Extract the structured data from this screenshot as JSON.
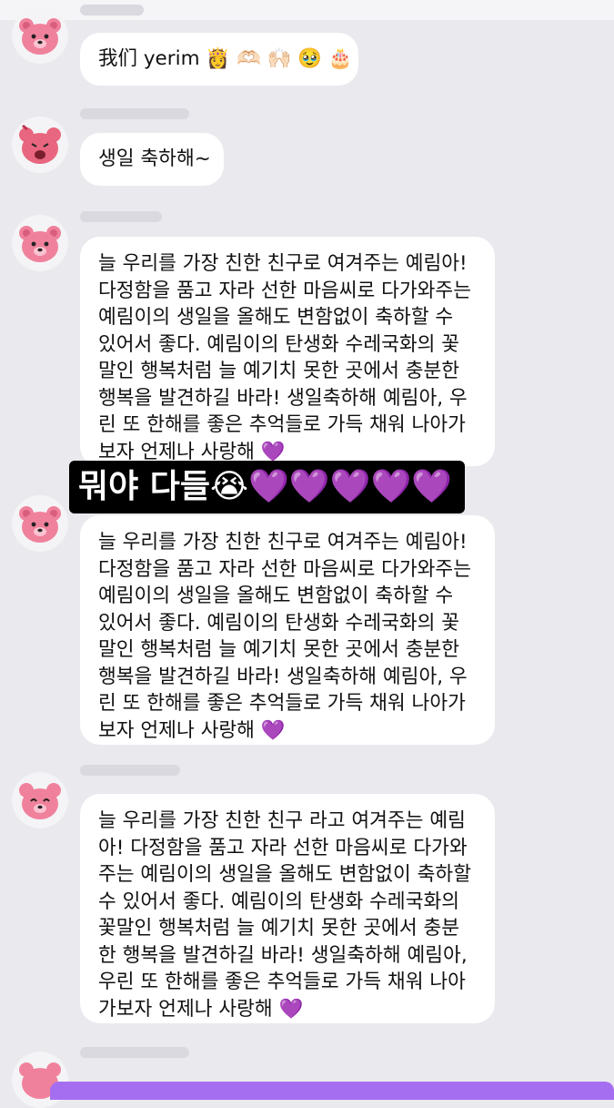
{
  "messages": [
    {
      "id": "m1",
      "text": "我们 yerim 👸 🫶🏻 🙌🏻 🥹 🎂"
    },
    {
      "id": "m2",
      "text": "생일 축하해~"
    },
    {
      "id": "m3",
      "lines": [
        "늘 우리를 가장 친한 친구로 여겨주는 예림아!",
        "다정함을 품고 자라 선한 마음씨로 다가와주는",
        "예림이의 생일을 올해도 변함없이 축하할 수",
        "있어서 좋다. 예림이의 탄생화 수레국화의 꽃",
        "말인 행복처럼 늘 예기치 못한 곳에서 충분한",
        "행복을 발견하길 바라! 생일축하해 예림아, 우",
        "린 또 한해를 좋은 추억들로 가득 채워 나아가",
        "보자 언제나 사랑해 💜"
      ]
    },
    {
      "id": "m4",
      "lines": [
        "늘 우리를 가장 친한 친구로 여겨주는 예림아!",
        "다정함을 품고 자라 선한 마음씨로 다가와주는",
        "예림이의 생일을 올해도 변함없이 축하할 수",
        "있어서 좋다. 예림이의 탄생화 수레국화의 꽃",
        "말인 행복처럼 늘 예기치 못한 곳에서 충분한",
        "행복을 발견하길 바라! 생일축하해 예림아, 우",
        "린 또 한해를 좋은 추억들로 가득 채워 나아가",
        "보자 언제나 사랑해 💜"
      ]
    },
    {
      "id": "m5",
      "lines": [
        "늘 우리를 가장 친한 친구 라고 여겨주는 예림",
        "아! 다정함을 품고 자라 선한 마음씨로 다가와",
        "주는 예림이의 생일을 올해도 변함없이 축하할",
        "수 있어서 좋다. 예림이의 탄생화 수레국화의",
        "꽃말인 행복처럼 늘 예기치 못한 곳에서 충분",
        "한 행복을 발견하길 바라! 생일축하해 예림아,",
        "우린 또 한해를 좋은 추억들로 가득 채워 나아",
        "가보자 언제나 사랑해 💜"
      ]
    }
  ],
  "sticker": {
    "text": "뭐야 다들",
    "emoji": "😭",
    "hearts": "💜💜💜💜💜"
  },
  "colors": {
    "background": "#e9e9ee",
    "bubble": "#ffffff",
    "accent": "#a56ef0",
    "heart": "#9b44e8"
  },
  "icons": {
    "avatar": "pink-bear-avatar-icon"
  }
}
